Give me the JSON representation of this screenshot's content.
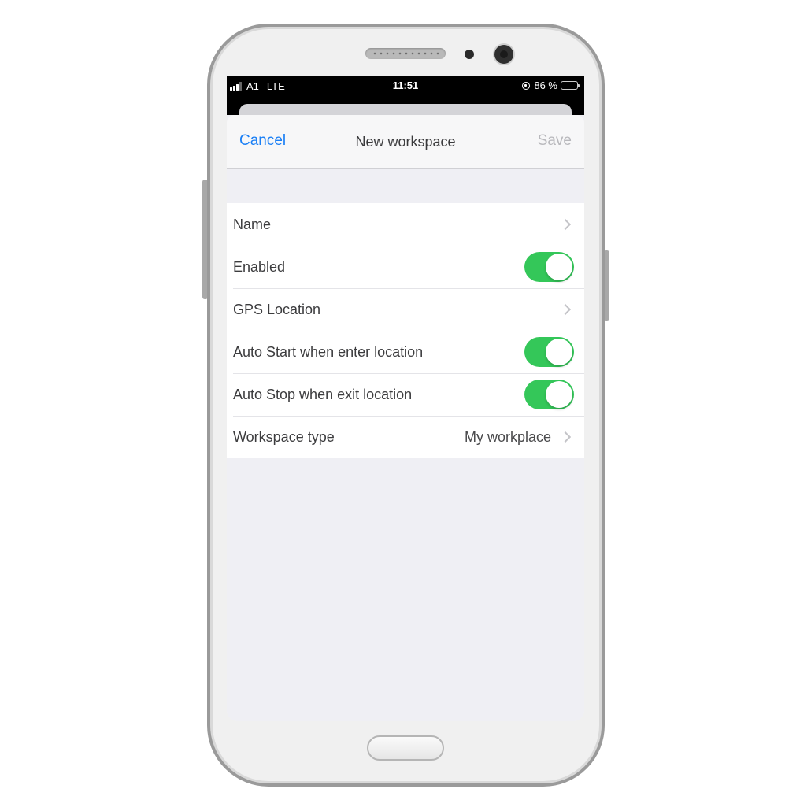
{
  "status_bar": {
    "carrier": "A1",
    "network": "LTE",
    "time": "11:51",
    "battery": "86 %",
    "battery_level": 0.86,
    "battery_color": "#f8d31a"
  },
  "navbar": {
    "cancel_label": "Cancel",
    "title": "New workspace",
    "save_label": "Save"
  },
  "settings": {
    "rows": [
      {
        "label": "Name",
        "kind": "chevron"
      },
      {
        "label": "Enabled",
        "kind": "toggle",
        "on": true
      },
      {
        "label": "GPS Location",
        "kind": "chevron"
      },
      {
        "label": "Auto Start when enter location",
        "kind": "toggle",
        "on": true
      },
      {
        "label": "Auto Stop when exit location",
        "kind": "toggle",
        "on": true
      },
      {
        "label": "Workspace type",
        "value": "My workplace",
        "kind": "chevron"
      }
    ]
  },
  "colors": {
    "accent": "#1a7ff5",
    "toggle_on": "#34c759",
    "disabled": "#b8b8bc"
  }
}
